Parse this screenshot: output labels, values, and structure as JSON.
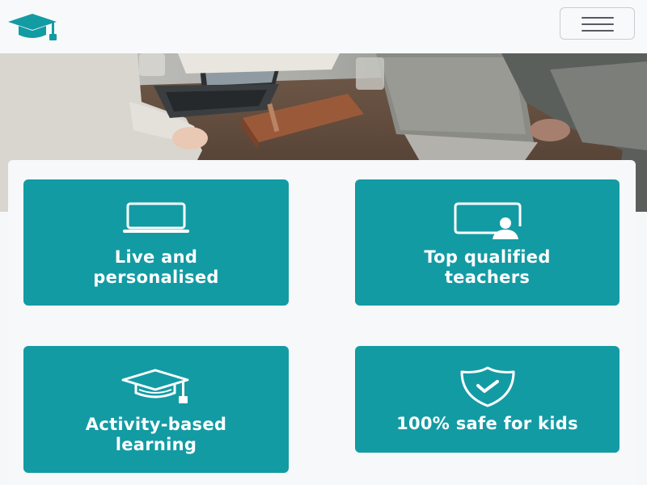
{
  "header": {
    "logo_icon": "graduation-cap-icon",
    "menu_icon": "hamburger-menu-icon"
  },
  "hero": {
    "image": "photo of people working at laptops on a wooden desk"
  },
  "features": [
    {
      "label": "Live and\npersonalised",
      "icon": "laptop-icon"
    },
    {
      "label": "Top qualified\nteachers",
      "icon": "teacher-board-icon"
    },
    {
      "label": "Activity-based\nlearning",
      "icon": "graduation-cap-icon"
    },
    {
      "label": "100% safe for kids",
      "icon": "shield-check-icon"
    }
  ],
  "colors": {
    "brand": "#139ba4",
    "navbar_background": "#f8f9fa",
    "page_background": "#f6f7f9",
    "card_text": "#ffffff"
  }
}
